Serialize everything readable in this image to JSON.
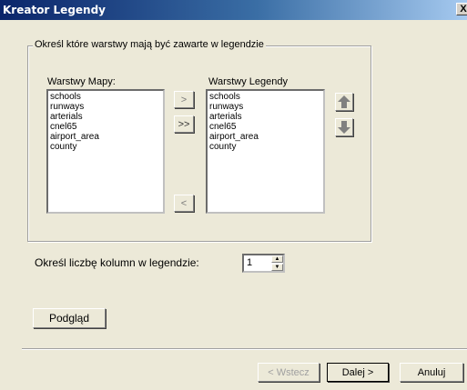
{
  "window": {
    "title": "Kreator Legendy",
    "close_glyph": "X"
  },
  "group": {
    "label": "Określ które warstwy mają być zawarte w legendzie"
  },
  "map_layers": {
    "label": "Warstwy Mapy:",
    "items": [
      "schools",
      "runways",
      "arterials",
      "cnel65",
      "airport_area",
      "county"
    ]
  },
  "legend_layers": {
    "label": "Warstwy Legendy",
    "items": [
      "schools",
      "runways",
      "arterials",
      "cnel65",
      "airport_area",
      "county"
    ]
  },
  "move_buttons": {
    "add_one": ">",
    "add_all": ">>",
    "remove_one": "<"
  },
  "order_buttons": {
    "up_icon": "arrow-up-icon",
    "down_icon": "arrow-down-icon",
    "color": "#808080"
  },
  "columns": {
    "label": "Określ liczbę kolumn w legendzie:",
    "value": "1"
  },
  "preview_button": {
    "label": "Podgląd"
  },
  "nav": {
    "back": "< Wstecz",
    "next": "Dalej >",
    "cancel": "Anuluj"
  }
}
